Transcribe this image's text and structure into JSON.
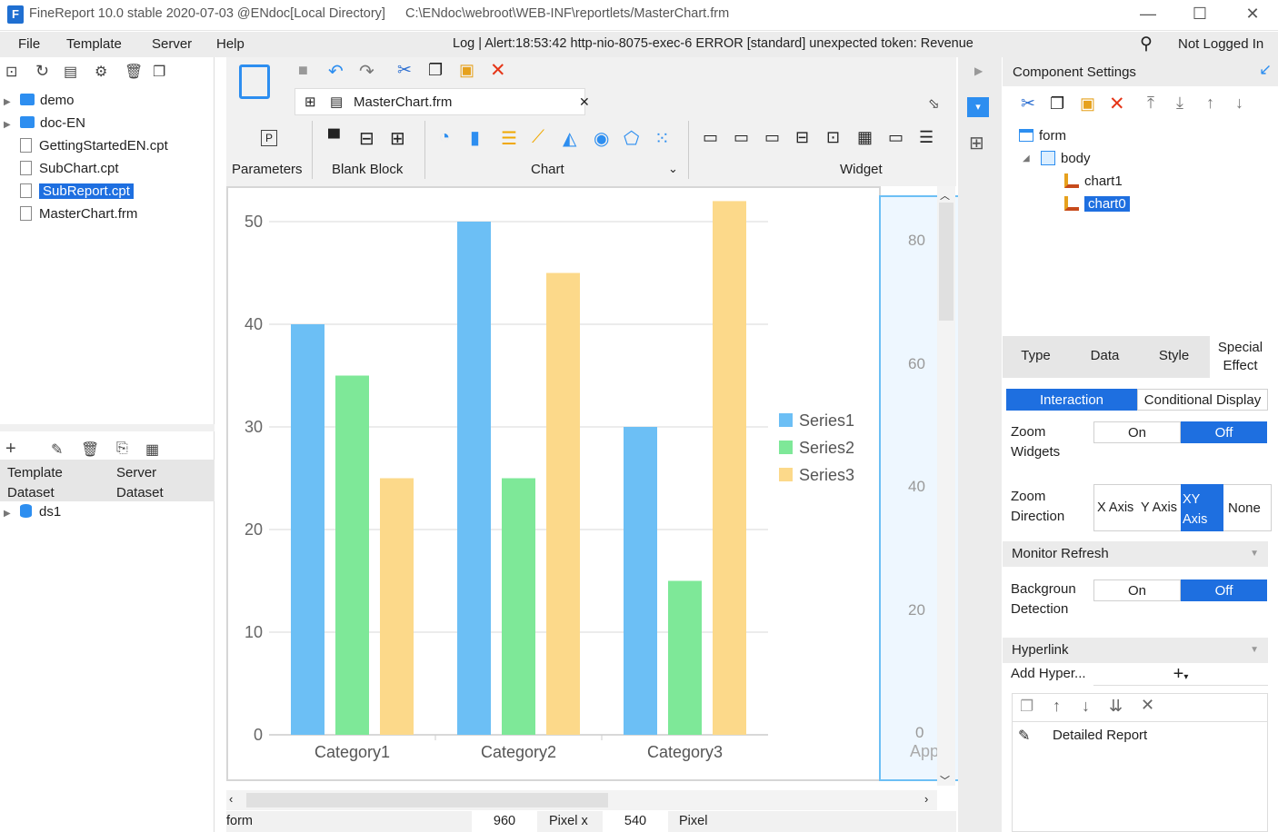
{
  "title": {
    "app": "FineReport 10.0 stable 2020-07-03 @ENdoc[Local Directory]",
    "path": "C:\\ENdoc\\webroot\\WEB-INF\\reportlets/MasterChart.frm"
  },
  "menu": [
    "File",
    "Template",
    "Server",
    "Help"
  ],
  "log": "Log | Alert:18:53:42 http-nio-8075-exec-6 ERROR [standard] unexpected token: Revenue",
  "user": "Not Logged In",
  "tree": [
    "demo",
    "doc-EN",
    "GettingStartedEN.cpt",
    "SubChart.cpt",
    "SubReport.cpt",
    "MasterChart.frm"
  ],
  "dataset_tabs": [
    "Template Dataset",
    "Server Dataset"
  ],
  "dataset_items": [
    "ds1"
  ],
  "file_tab": "MasterChart.frm",
  "ribbon_groups": [
    "Parameters",
    "Blank Block",
    "Chart",
    "Widget"
  ],
  "right_title": "Component Settings",
  "comp_tree": [
    "form",
    "body",
    "chart1",
    "chart0"
  ],
  "prop_tabs": [
    "Type",
    "Data",
    "Style",
    "Special Effect"
  ],
  "sub_tabs": [
    "Interaction",
    "Conditional Display"
  ],
  "props": {
    "zoom_widgets": "Zoom Widgets",
    "on": "On",
    "off": "Off",
    "zoom_direction": "Zoom Direction",
    "dirs": [
      "X Axis",
      "Y Axis",
      "XY Axis",
      "None"
    ],
    "monitor_refresh": "Monitor Refresh",
    "bg_detection": "Backgroun Detection",
    "hyperlink": "Hyperlink",
    "add_hyper": "Add Hyper...",
    "detailed": "Detailed Report"
  },
  "status": {
    "form": "form",
    "w": "960",
    "pixel_x": "Pixel  x",
    "h": "540",
    "pixel": "Pixel"
  },
  "chart_data": {
    "type": "bar",
    "categories": [
      "Category1",
      "Category2",
      "Category3"
    ],
    "series": [
      {
        "name": "Series1",
        "values": [
          40,
          50,
          30
        ],
        "color": "#6cbff5"
      },
      {
        "name": "Series2",
        "values": [
          35,
          25,
          15
        ],
        "color": "#7ee898"
      },
      {
        "name": "Series3",
        "values": [
          25,
          45,
          52
        ],
        "color": "#fcd98a"
      }
    ],
    "ylim": [
      0,
      52
    ],
    "yticks": [
      0,
      10,
      20,
      30,
      40,
      50
    ],
    "grid": true,
    "legend": "right"
  },
  "side_chart": {
    "yticks": [
      "80",
      "60",
      "40",
      "20",
      "0"
    ],
    "partial_label": "App"
  }
}
